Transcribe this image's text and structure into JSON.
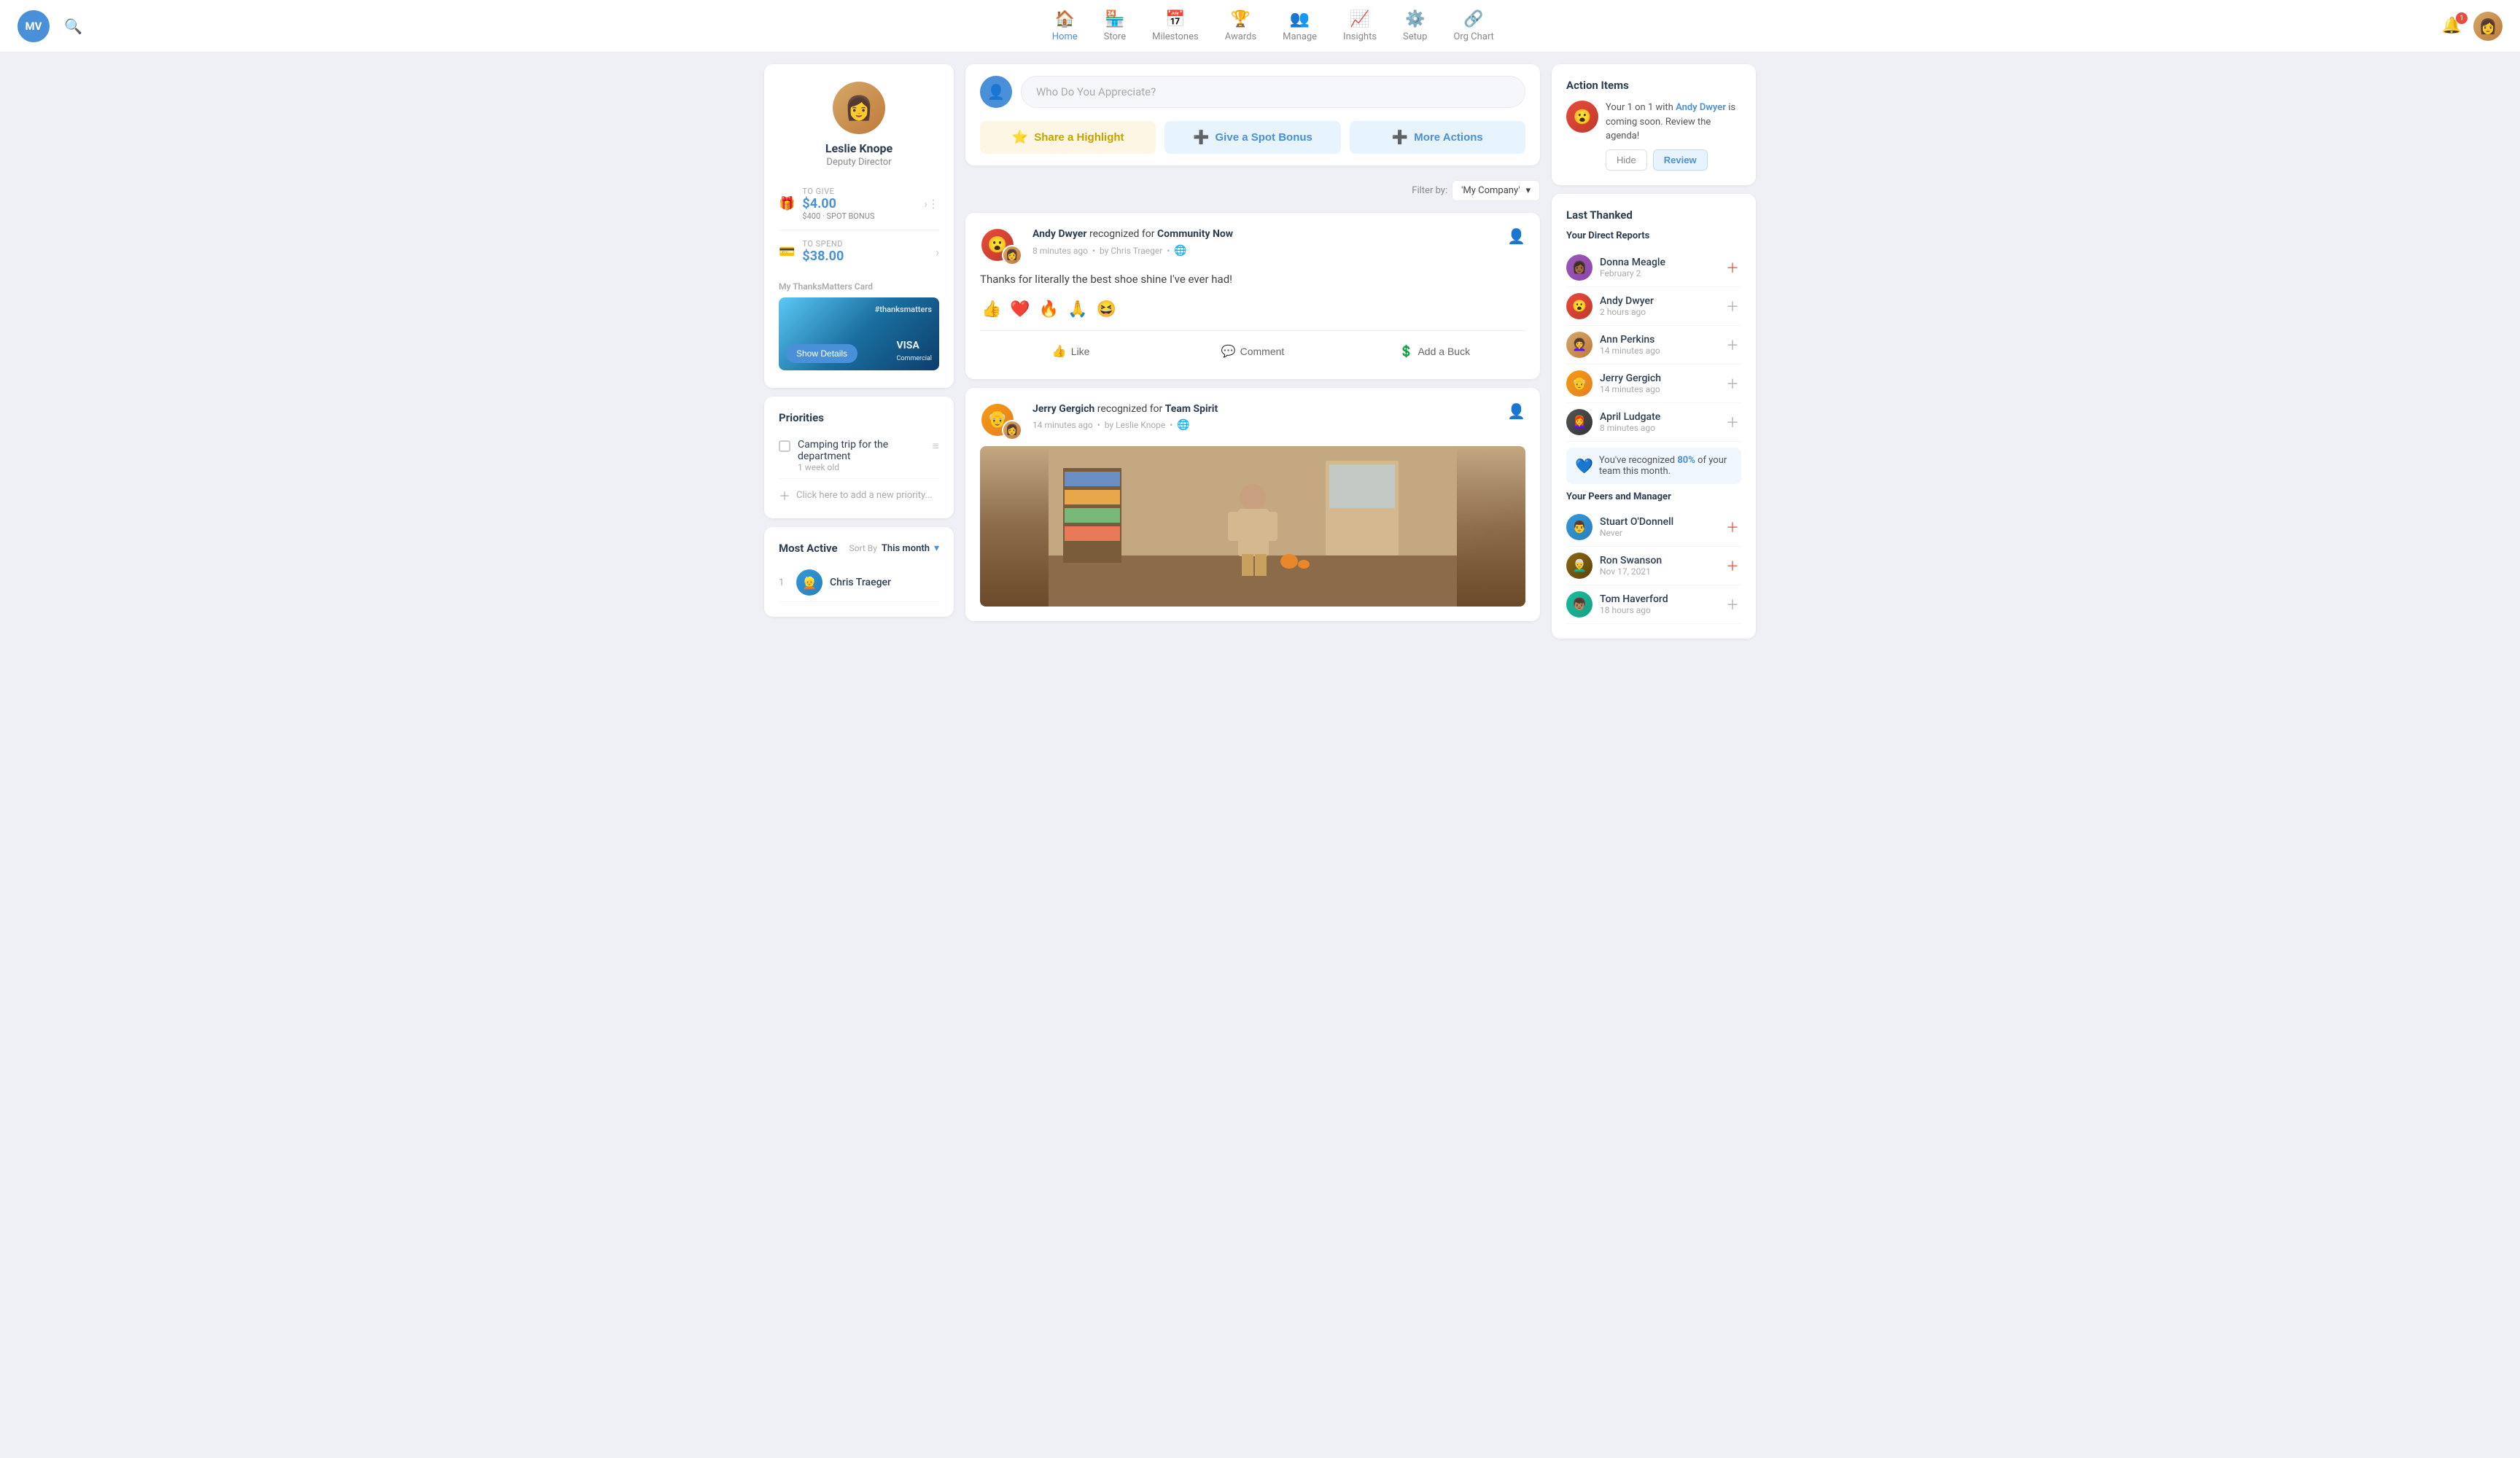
{
  "app": {
    "logo": "MV",
    "logoColor": "#4a90d9"
  },
  "nav": {
    "items": [
      {
        "id": "home",
        "label": "Home",
        "icon": "🏠",
        "active": true
      },
      {
        "id": "store",
        "label": "Store",
        "icon": "🏪",
        "active": false
      },
      {
        "id": "milestones",
        "label": "Milestones",
        "icon": "📅",
        "active": false
      },
      {
        "id": "awards",
        "label": "Awards",
        "icon": "🏆",
        "active": false
      },
      {
        "id": "manage",
        "label": "Manage",
        "icon": "👥",
        "active": false
      },
      {
        "id": "insights",
        "label": "Insights",
        "icon": "📈",
        "active": false
      },
      {
        "id": "setup",
        "label": "Setup",
        "icon": "⚙️",
        "active": false
      },
      {
        "id": "org-chart",
        "label": "Org Chart",
        "icon": "🔗",
        "active": false
      }
    ],
    "notifications": {
      "count": "1"
    },
    "userAvatar": "👩"
  },
  "profile": {
    "name": "Leslie Knope",
    "title": "Deputy Director",
    "avatar": "👩",
    "toGive": {
      "label": "TO GIVE",
      "amount": "$4.00",
      "sub": "$400 · SPOT BONUS",
      "icon": "🎁"
    },
    "toSpend": {
      "label": "TO SPEND",
      "amount": "$38.00",
      "icon": "💳"
    },
    "card": {
      "label": "My ThanksMatters Card",
      "hashtag": "#thanksmatters",
      "showDetails": "Show Details",
      "brand": "VISA Commercial"
    }
  },
  "priorities": {
    "title": "Priorities",
    "items": [
      {
        "text": "Camping trip for the department",
        "age": "1 week old"
      }
    ],
    "addPlaceholder": "Click here to add a new priority..."
  },
  "mostActive": {
    "title": "Most Active",
    "sortLabel": "Sort By",
    "sortValue": "This month",
    "people": [
      {
        "rank": "1",
        "name": "Chris Traeger",
        "avatar": "👱"
      }
    ]
  },
  "feed": {
    "appreciatePrompt": "Who Do You Appreciate?",
    "buttons": {
      "highlight": "Share a Highlight",
      "bonus": "Give a Spot Bonus",
      "more": "More Actions"
    },
    "filter": {
      "label": "Filter by:",
      "value": "'My Company'"
    },
    "posts": [
      {
        "id": "post1",
        "author": "Andy Dwyer",
        "authorAvatar": "👦",
        "authorAvatarClass": "av-red",
        "subAvatar": "👩‍🦱",
        "subAvatarClass": "av-leslie",
        "action": "recognized for",
        "badge": "Community Now",
        "timeAgo": "8 minutes ago",
        "by": "by Chris Traeger",
        "globe": "🌐",
        "message": "Thanks for literally the best shoe shine I've ever had!",
        "reactions": [
          "👍",
          "❤️",
          "🔥",
          "🙏",
          "😆"
        ],
        "actions": {
          "like": "Like",
          "comment": "Comment",
          "buck": "Add a Buck"
        },
        "hasImage": false
      },
      {
        "id": "post2",
        "author": "Jerry Gergich",
        "authorAvatar": "👴",
        "authorAvatarClass": "av-orange",
        "subAvatar": "👩",
        "subAvatarClass": "av-leslie",
        "action": "recognized for",
        "badge": "Team Spirit",
        "timeAgo": "14 minutes ago",
        "by": "by Leslie Knope",
        "globe": "🌐",
        "message": "",
        "hasImage": true
      }
    ]
  },
  "actionItems": {
    "title": "Action Items",
    "item": {
      "personName": "Andy Dwyer",
      "text1": "Your 1 on 1 with ",
      "text2": " is coming soon. Review the agenda!",
      "avatar": "😮",
      "avatarClass": "av-red",
      "hideLabel": "Hide",
      "reviewLabel": "Review"
    }
  },
  "lastThanked": {
    "title": "Last Thanked",
    "directReports": {
      "subtitle": "Your Direct Reports",
      "people": [
        {
          "name": "Donna Meagle",
          "time": "February 2",
          "avatar": "👩🏾",
          "avClass": "av-purple",
          "addColor": "red"
        },
        {
          "name": "Andy Dwyer",
          "time": "2 hours ago",
          "avatar": "😮",
          "avClass": "av-red",
          "addColor": "gray"
        },
        {
          "name": "Ann Perkins",
          "time": "14 minutes ago",
          "avatar": "👩‍🦱",
          "avClass": "av-leslie",
          "addColor": "gray"
        },
        {
          "name": "Jerry Gergich",
          "time": "14 minutes ago",
          "avatar": "👴",
          "avClass": "av-orange",
          "addColor": "gray"
        },
        {
          "name": "April Ludgate",
          "time": "8 minutes ago",
          "avatar": "👩‍🦰",
          "avClass": "av-dark",
          "addColor": "gray"
        }
      ],
      "recognized": {
        "text1": "You've recognized ",
        "pct": "80%",
        "text2": " of your team this month.",
        "icon": "💙"
      }
    },
    "peersAndManager": {
      "subtitle": "Your Peers and Manager",
      "people": [
        {
          "name": "Stuart O'Donnell",
          "time": "Never",
          "avatar": "👨",
          "avClass": "av-blue",
          "addColor": "red"
        },
        {
          "name": "Ron Swanson",
          "time": "Nov 17, 2021",
          "avatar": "👨‍🦳",
          "avClass": "av-brown",
          "addColor": "red"
        },
        {
          "name": "Tom Haverford",
          "time": "18 hours ago",
          "avatar": "👦🏽",
          "avClass": "av-teal",
          "addColor": "gray"
        }
      ]
    }
  }
}
